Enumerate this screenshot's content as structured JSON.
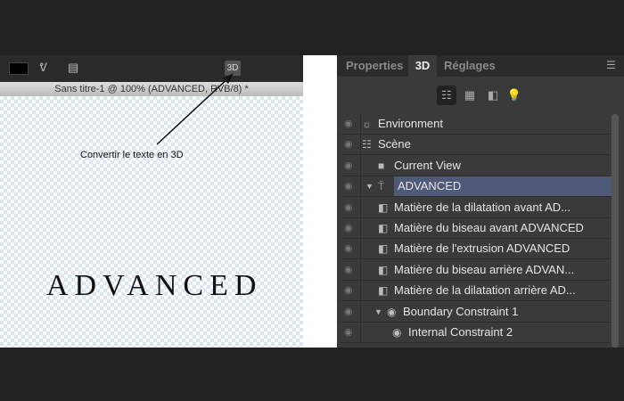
{
  "document": {
    "title": "Sans titre-1 @ 100% (ADVANCED, RVB/8) *",
    "canvas_text": "ADVANCED",
    "annotation": "Convertir le texte en 3D",
    "btn_3d": "3D"
  },
  "panel": {
    "tabs": [
      "Properties",
      "3D",
      "Réglages"
    ],
    "active_tab": "3D",
    "rows": [
      {
        "label": "Environment",
        "icon": "environment-icon"
      },
      {
        "label": "Scène",
        "icon": "scene-icon"
      },
      {
        "label": "Current View",
        "icon": "camera-icon"
      },
      {
        "label": "ADVANCED",
        "icon": "mesh-icon",
        "selected": true
      },
      {
        "label": "Matière de la dilatation avant AD...",
        "icon": "material-icon"
      },
      {
        "label": "Matière du biseau avant ADVANCED",
        "icon": "material-icon"
      },
      {
        "label": "Matière de l'extrusion ADVANCED",
        "icon": "material-icon"
      },
      {
        "label": "Matière du biseau arrière ADVAN...",
        "icon": "material-icon"
      },
      {
        "label": "Matière de la dilatation arrière AD...",
        "icon": "material-icon"
      },
      {
        "label": "Boundary Constraint 1",
        "icon": "constraint-icon"
      },
      {
        "label": "Internal Constraint 2",
        "icon": "constraint-icon"
      }
    ]
  }
}
